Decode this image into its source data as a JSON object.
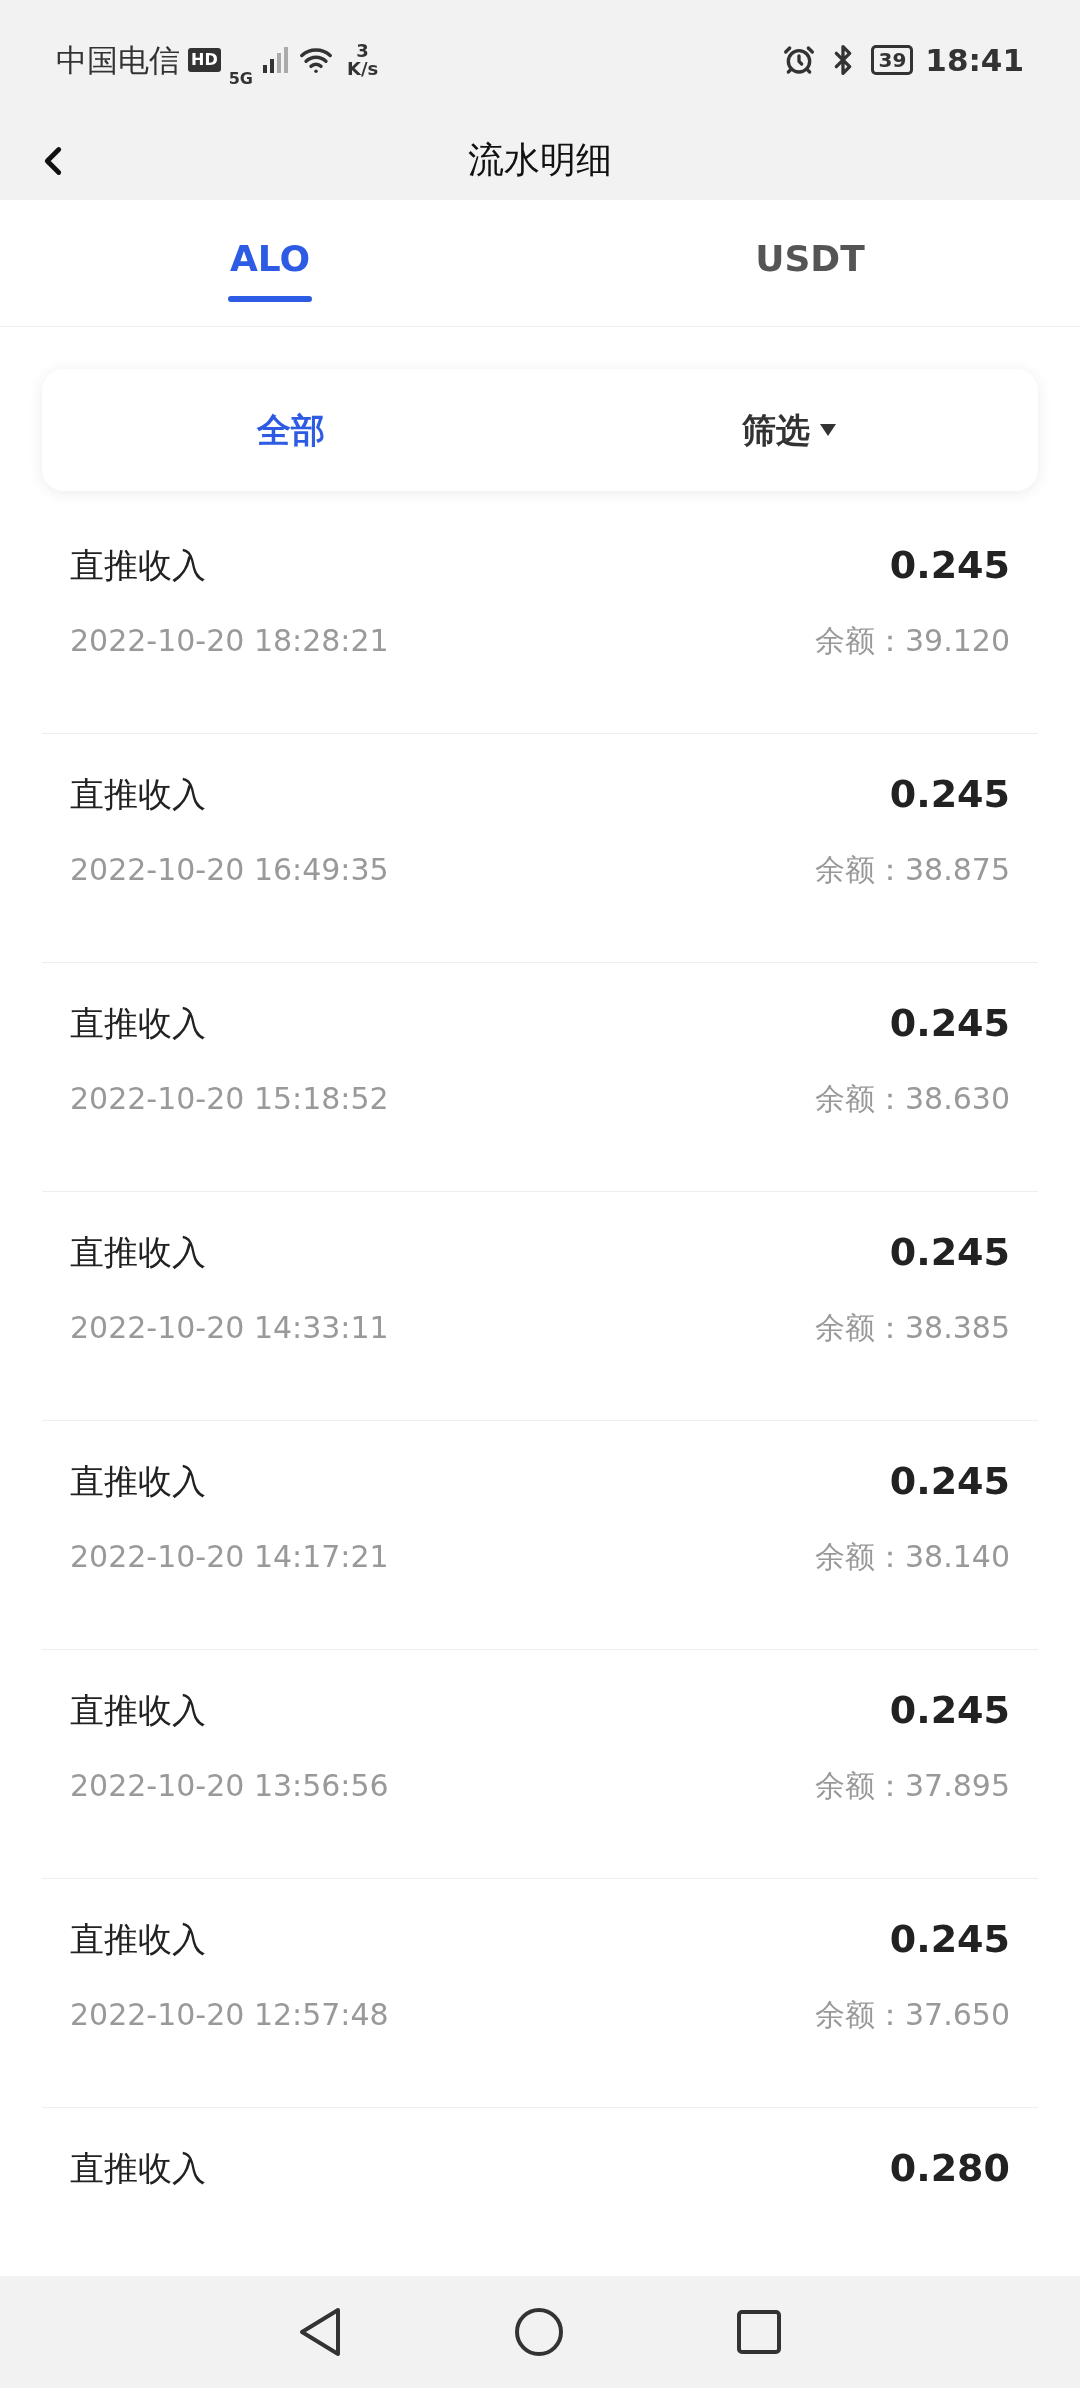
{
  "status_bar": {
    "carrier": "中国电信",
    "hd": "HD",
    "network": "5G",
    "speed_value": "3",
    "speed_unit": "K/s",
    "battery": "39",
    "time": "18:41"
  },
  "header": {
    "title": "流水明细"
  },
  "tabs": [
    {
      "label": "ALO",
      "selected": true
    },
    {
      "label": "USDT",
      "selected": false
    }
  ],
  "filters": [
    {
      "label": "全部",
      "selected": true,
      "dropdown": false
    },
    {
      "label": "筛选",
      "selected": false,
      "dropdown": true
    }
  ],
  "records": [
    {
      "title": "直推收入",
      "amount": "0.245",
      "time": "2022-10-20 18:28:21",
      "balance": "余额：39.120"
    },
    {
      "title": "直推收入",
      "amount": "0.245",
      "time": "2022-10-20 16:49:35",
      "balance": "余额：38.875"
    },
    {
      "title": "直推收入",
      "amount": "0.245",
      "time": "2022-10-20 15:18:52",
      "balance": "余额：38.630"
    },
    {
      "title": "直推收入",
      "amount": "0.245",
      "time": "2022-10-20 14:33:11",
      "balance": "余额：38.385"
    },
    {
      "title": "直推收入",
      "amount": "0.245",
      "time": "2022-10-20 14:17:21",
      "balance": "余额：38.140"
    },
    {
      "title": "直推收入",
      "amount": "0.245",
      "time": "2022-10-20 13:56:56",
      "balance": "余额：37.895"
    },
    {
      "title": "直推收入",
      "amount": "0.245",
      "time": "2022-10-20 12:57:48",
      "balance": "余额：37.650"
    },
    {
      "title": "直推收入",
      "amount": "0.280"
    }
  ]
}
